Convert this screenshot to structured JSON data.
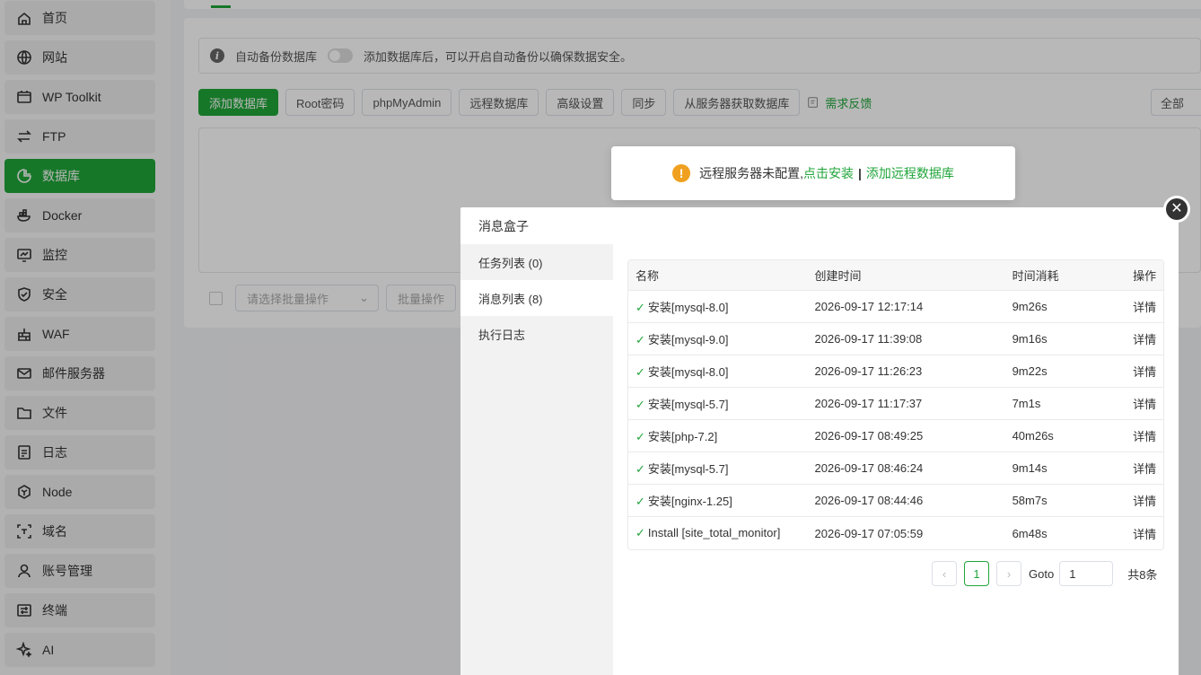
{
  "sidebar": {
    "items": [
      {
        "label": "首页",
        "icon": "home-icon"
      },
      {
        "label": "网站",
        "icon": "globe-icon"
      },
      {
        "label": "WP Toolkit",
        "icon": "wp-toolkit-icon"
      },
      {
        "label": "FTP",
        "icon": "ftp-icon"
      },
      {
        "label": "数据库",
        "icon": "database-icon",
        "active": true
      },
      {
        "label": "Docker",
        "icon": "docker-icon"
      },
      {
        "label": "监控",
        "icon": "monitor-icon"
      },
      {
        "label": "安全",
        "icon": "shield-icon"
      },
      {
        "label": "WAF",
        "icon": "firewall-icon"
      },
      {
        "label": "邮件服务器",
        "icon": "mail-icon"
      },
      {
        "label": "文件",
        "icon": "folder-icon"
      },
      {
        "label": "日志",
        "icon": "log-icon"
      },
      {
        "label": "Node",
        "icon": "node-icon"
      },
      {
        "label": "域名",
        "icon": "domain-icon"
      },
      {
        "label": "账号管理",
        "icon": "user-icon"
      },
      {
        "label": "终端",
        "icon": "terminal-icon"
      },
      {
        "label": "AI",
        "icon": "ai-sparkle-icon"
      }
    ]
  },
  "main": {
    "info_bar": {
      "label": "自动备份数据库",
      "hint": "添加数据库后，可以开启自动备份以确保数据安全。"
    },
    "toolbar": {
      "add_db": "添加数据库",
      "root_pwd": "Root密码",
      "phpmyadmin": "phpMyAdmin",
      "remote_db": "远程数据库",
      "advanced": "高级设置",
      "sync": "同步",
      "fetch": "从服务器获取数据库",
      "feedback": "需求反馈",
      "filter": "全部"
    },
    "footer": {
      "batch_placeholder": "请选择批量操作",
      "batch_button": "批量操作"
    },
    "warning": {
      "text": "远程服务器未配置,",
      "install_link": "点击安装",
      "separator": "|",
      "add_remote_link": "添加远程数据库"
    }
  },
  "modal": {
    "title": "消息盒子",
    "tabs": [
      {
        "label": "任务列表 (0)"
      },
      {
        "label": "消息列表 (8)",
        "active": true
      },
      {
        "label": "执行日志"
      }
    ],
    "table": {
      "headers": {
        "name": "名称",
        "created": "创建时间",
        "elapsed": "时间消耗",
        "action": "操作"
      },
      "rows": [
        {
          "name": "安装[mysql-8.0]",
          "created": "2026-09-17 12:17:14",
          "elapsed": "9m26s",
          "action": "详情"
        },
        {
          "name": "安装[mysql-9.0]",
          "created": "2026-09-17 11:39:08",
          "elapsed": "9m16s",
          "action": "详情"
        },
        {
          "name": "安装[mysql-8.0]",
          "created": "2026-09-17 11:26:23",
          "elapsed": "9m22s",
          "action": "详情"
        },
        {
          "name": "安装[mysql-5.7]",
          "created": "2026-09-17 11:17:37",
          "elapsed": "7m1s",
          "action": "详情"
        },
        {
          "name": "安装[php-7.2]",
          "created": "2026-09-17 08:49:25",
          "elapsed": "40m26s",
          "action": "详情"
        },
        {
          "name": "安装[mysql-5.7]",
          "created": "2026-09-17 08:46:24",
          "elapsed": "9m14s",
          "action": "详情"
        },
        {
          "name": "安装[nginx-1.25]",
          "created": "2026-09-17 08:44:46",
          "elapsed": "58m7s",
          "action": "详情"
        },
        {
          "name": "Install [site_total_monitor]",
          "created": "2026-09-17 07:05:59",
          "elapsed": "6m48s",
          "action": "详情"
        }
      ]
    },
    "pager": {
      "prev": "‹",
      "current": "1",
      "next": "›",
      "goto_label": "Goto",
      "goto_value": "1",
      "total": "共8条"
    }
  },
  "colors": {
    "accent": "#20a53a",
    "warning": "#f0a020"
  }
}
